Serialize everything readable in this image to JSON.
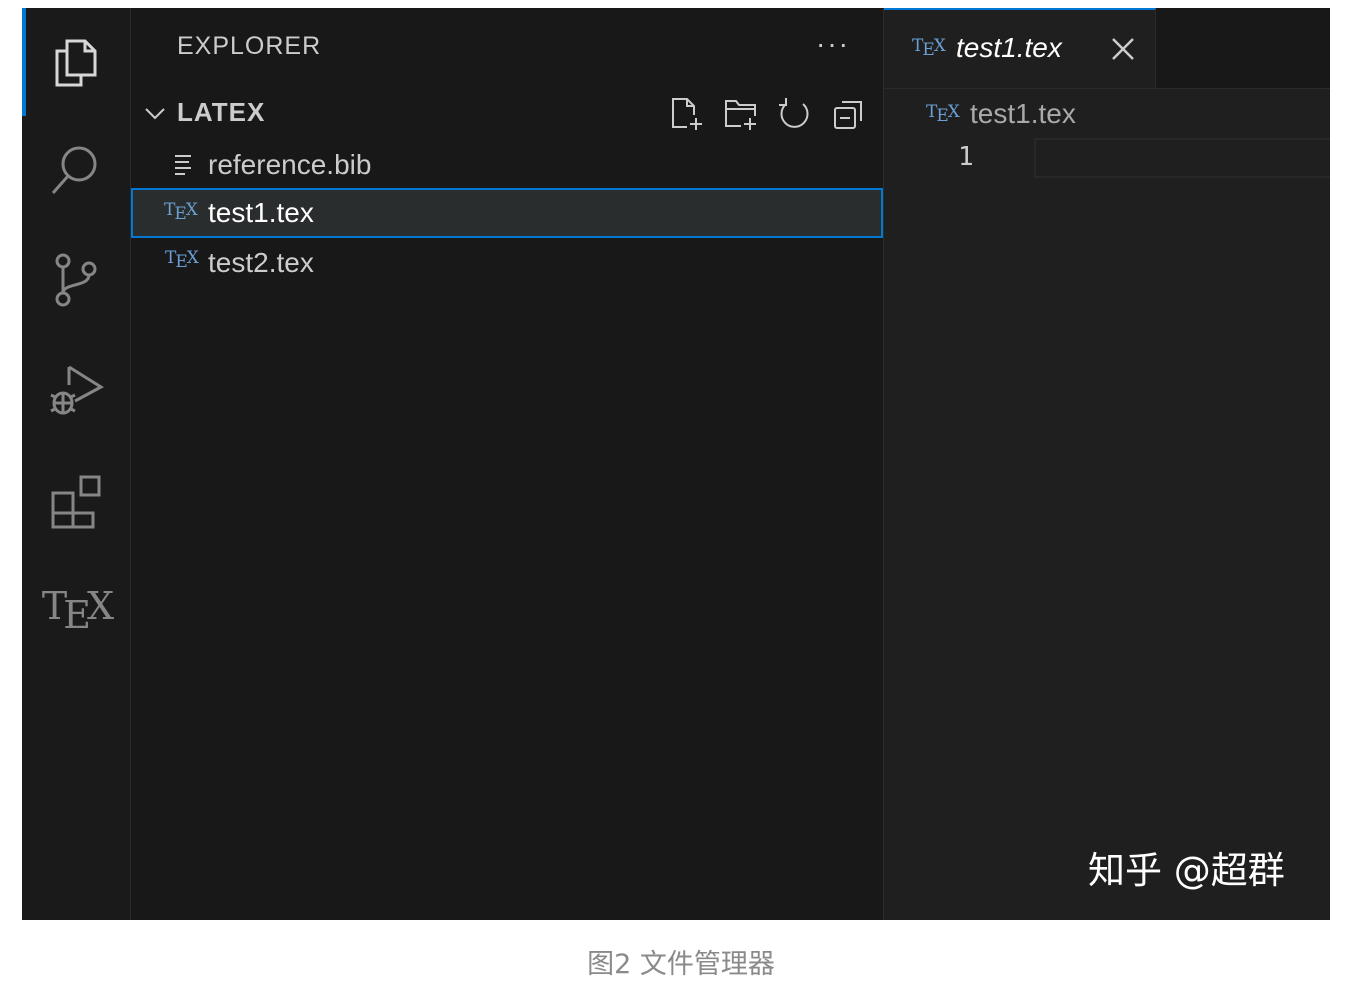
{
  "activity_bar": {
    "items": [
      {
        "name": "explorer",
        "icon": "files-icon",
        "active": true
      },
      {
        "name": "search",
        "icon": "search-icon"
      },
      {
        "name": "source-control",
        "icon": "source-control-icon"
      },
      {
        "name": "run-and-debug",
        "icon": "run-debug-icon"
      },
      {
        "name": "extensions",
        "icon": "extensions-icon"
      },
      {
        "name": "tex",
        "icon": "tex-icon",
        "label_t": "T",
        "label_e": "E",
        "label_x": "X"
      }
    ]
  },
  "sidebar": {
    "title": "EXPLORER",
    "more_label": "···",
    "folder": {
      "name": "LATEX",
      "actions": [
        "new-file-icon",
        "new-folder-icon",
        "refresh-icon",
        "collapse-all-icon"
      ]
    },
    "files": [
      {
        "label": "reference.bib",
        "icon": "bib-file-icon",
        "selected": false
      },
      {
        "label": "test1.tex",
        "icon": "tex-file-icon",
        "selected": true
      },
      {
        "label": "test2.tex",
        "icon": "tex-file-icon",
        "selected": false
      }
    ]
  },
  "editor": {
    "tab": {
      "label": "test1.tex",
      "icon": "tex-file-icon",
      "close": "close-icon"
    },
    "breadcrumb": {
      "label": "test1.tex"
    },
    "line_number": "1"
  },
  "tex_mini": {
    "t": "T",
    "e": "E",
    "x": "X"
  },
  "watermark": "知乎 @超群",
  "caption": "图2 文件管理器",
  "colors": {
    "accent": "#0078d4",
    "tex_icon": "#6a9fd4",
    "foreground": "#cccccc"
  }
}
